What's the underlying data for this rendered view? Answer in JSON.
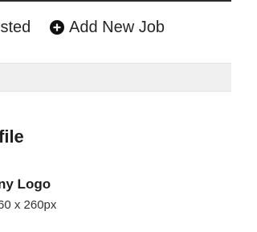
{
  "nav": {
    "jobs_listed_label": "isted",
    "add_new_job_label": "Add New Job"
  },
  "icons": {
    "add": "plus-circle-icon"
  },
  "profile": {
    "section_title": "file",
    "logo_label": "ny Logo",
    "logo_size_hint": "60 x 260px"
  }
}
